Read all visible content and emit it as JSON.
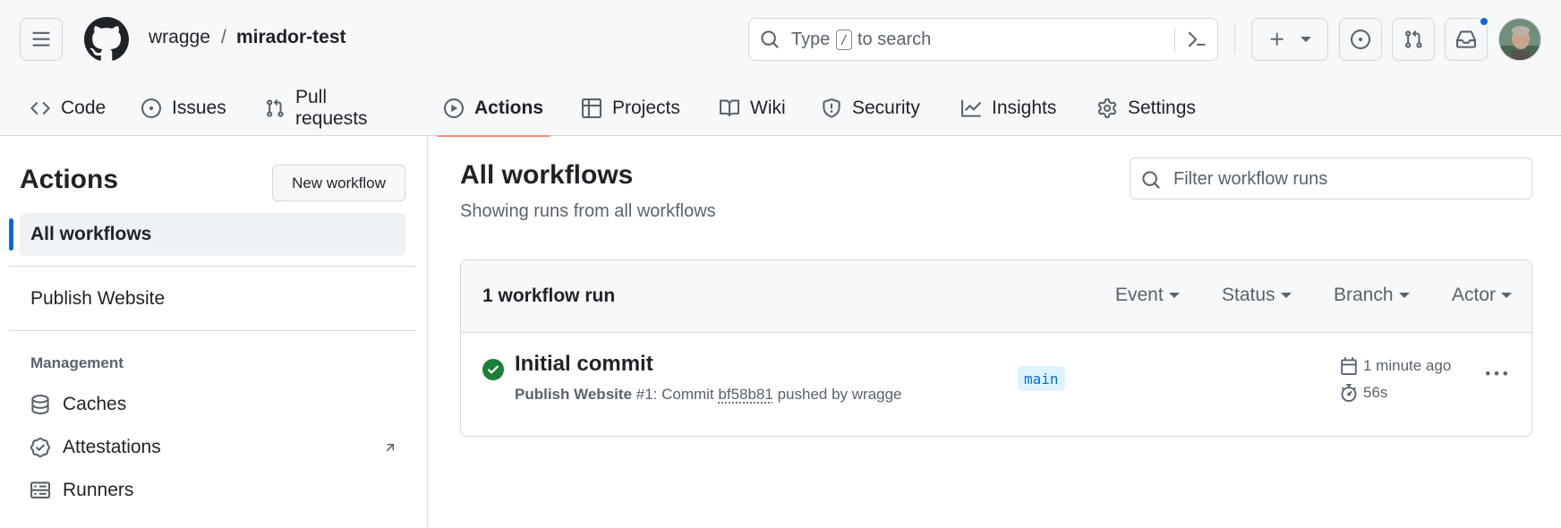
{
  "header": {
    "owner": "wragge",
    "separator": "/",
    "repo": "mirador-test",
    "search": {
      "prefix": "Type",
      "key": "/",
      "suffix": "to search"
    }
  },
  "nav": {
    "items": [
      {
        "label": "Code",
        "icon": "code-icon"
      },
      {
        "label": "Issues",
        "icon": "issue-opened-icon"
      },
      {
        "label": "Pull requests",
        "icon": "git-pull-request-icon"
      },
      {
        "label": "Actions",
        "icon": "play-icon",
        "active": true
      },
      {
        "label": "Projects",
        "icon": "table-icon"
      },
      {
        "label": "Wiki",
        "icon": "book-icon"
      },
      {
        "label": "Security",
        "icon": "shield-icon"
      },
      {
        "label": "Insights",
        "icon": "graph-icon"
      },
      {
        "label": "Settings",
        "icon": "gear-icon"
      }
    ]
  },
  "sidebar": {
    "title": "Actions",
    "new_workflow": "New workflow",
    "all_workflows": "All workflows",
    "workflows": [
      "Publish Website"
    ],
    "management_heading": "Management",
    "management": [
      {
        "label": "Caches",
        "icon": "database-icon"
      },
      {
        "label": "Attestations",
        "icon": "verified-icon"
      },
      {
        "label": "Runners",
        "icon": "server-icon"
      }
    ]
  },
  "main": {
    "title": "All workflows",
    "subtitle": "Showing runs from all workflows",
    "filter_placeholder": "Filter workflow runs",
    "runs_count": "1 workflow run",
    "filters": [
      "Event",
      "Status",
      "Branch",
      "Actor"
    ],
    "run": {
      "title": "Initial commit",
      "workflow": "Publish Website",
      "number": "#1",
      "commit_prefix": ": Commit",
      "sha": "bf58b81",
      "pushed_by": "pushed by wragge",
      "branch": "main",
      "time": "1 minute ago",
      "duration": "56s",
      "status": "success"
    }
  },
  "colors": {
    "accent": "#0969da",
    "success": "#1a7f37",
    "active_underline": "#fd8c73",
    "branch_bg": "#ddf4ff"
  }
}
